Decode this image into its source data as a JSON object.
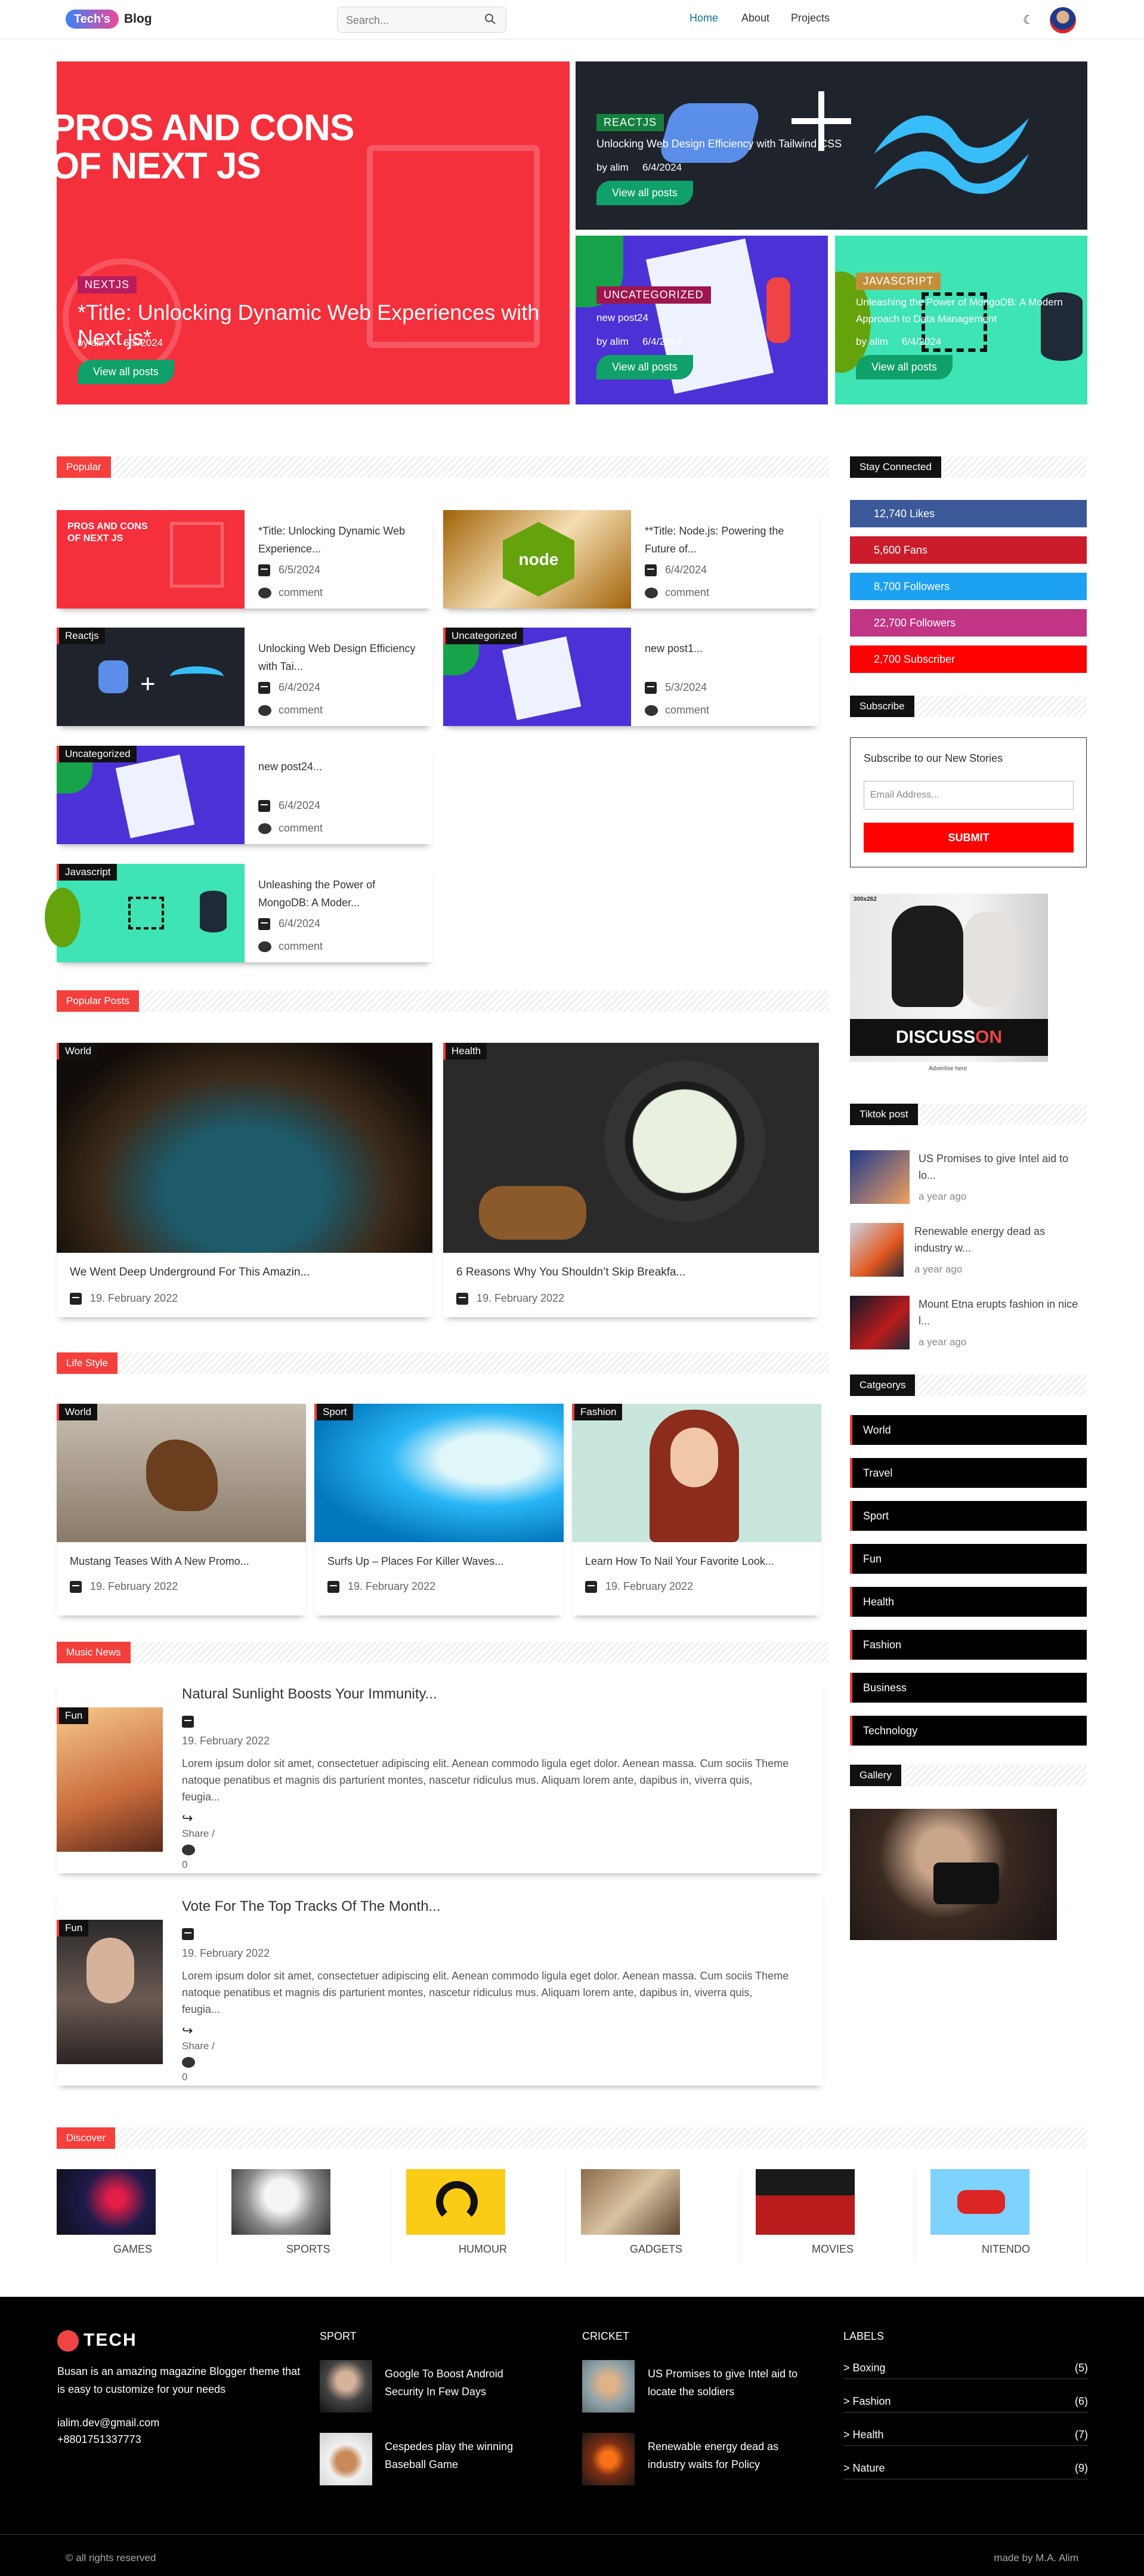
{
  "header": {
    "logo_badge": "Tech's",
    "logo_text": "Blog",
    "search_placeholder": "Search...",
    "nav": [
      "Home",
      "About",
      "Projects"
    ],
    "theme_icon": "moon-icon"
  },
  "hero": {
    "big": {
      "tag": "NEXTJS",
      "art_text_1": "PROS AND CONS",
      "art_text_2": "OF NEXT JS",
      "title": "*Title: Unlocking Dynamic Web Experiences with Next.js*",
      "author": "by alim",
      "date": "6/5/2024",
      "button": "View all posts"
    },
    "top_right": {
      "tag": "REACTJS",
      "title": "Unlocking Web Design Efficiency with Tailwind CSS",
      "author": "by alim",
      "date": "6/4/2024",
      "button": "View all posts"
    },
    "bottom_left": {
      "tag": "UNCATEGORIZED",
      "title": "new post24",
      "author": "by alim",
      "date": "6/4/2024",
      "button": "View all posts"
    },
    "bottom_right": {
      "tag": "JAVASCRIPT",
      "title": "Unleashing the Power of MongoDB: A Modern Approach to Data Management",
      "author": "by alim",
      "date": "6/4/2024",
      "button": "View all posts"
    }
  },
  "popular": {
    "heading": "Popular",
    "items": [
      {
        "tag": "",
        "art_text": "PROS AND CONS OF NEXT JS",
        "title": "*Title: Unlocking Dynamic Web Experience...",
        "date": "6/5/2024",
        "comment": "comment"
      },
      {
        "tag": "",
        "art_text": "node",
        "title": "**Title: Node.js: Powering the Future of...",
        "date": "6/4/2024",
        "comment": "comment"
      },
      {
        "tag": "Reactjs",
        "title": "Unlocking Web Design Efficiency with Tai...",
        "date": "6/4/2024",
        "comment": "comment"
      },
      {
        "tag": "Uncategorized",
        "title": "new post1...",
        "date": "5/3/2024",
        "comment": "comment"
      },
      {
        "tag": "Uncategorized",
        "title": "new post24...",
        "date": "6/4/2024",
        "comment": "comment"
      },
      {
        "tag": "Javascript",
        "title": "Unleashing the Power of MongoDB: A Moder...",
        "date": "6/4/2024",
        "comment": "comment"
      }
    ]
  },
  "popular_posts": {
    "heading": "Popular Posts",
    "items": [
      {
        "tag": "World",
        "title": "We Went Deep Underground For This Amazin...",
        "date": "19. February 2022"
      },
      {
        "tag": "Health",
        "title": "6 Reasons Why You Shouldn’t Skip Breakfa...",
        "date": "19. February 2022"
      }
    ]
  },
  "life_style": {
    "heading": "Life Style",
    "items": [
      {
        "tag": "World",
        "title": "Mustang Teases With A New Promo...",
        "date": "19. February 2022"
      },
      {
        "tag": "Sport",
        "title": "Surfs Up – Places For Killer Waves...",
        "date": "19. February 2022"
      },
      {
        "tag": "Fashion",
        "title": "Learn How To Nail Your Favorite Look...",
        "date": "19. February 2022"
      }
    ]
  },
  "music_news": {
    "heading": "Music News",
    "items": [
      {
        "tag": "Fun",
        "title": "Natural Sunlight Boosts Your Immunity...",
        "date": "19. February 2022",
        "body": "Lorem ipsum dolor sit amet, consectetuer adipiscing elit. Aenean commodo ligula eget dolor. Aenean massa. Cum sociis Theme natoque penatibus et magnis dis parturient montes, nascetur ridiculus mus. Aliquam lorem ante, dapibus in, viverra quis, feugia...",
        "share": "Share /",
        "comments": "0"
      },
      {
        "tag": "Fun",
        "title": "Vote For The Top Tracks Of The Month...",
        "date": "19. February 2022",
        "body": "Lorem ipsum dolor sit amet, consectetuer adipiscing elit. Aenean commodo ligula eget dolor. Aenean massa. Cum sociis Theme natoque penatibus et magnis dis parturient montes, nascetur ridiculus mus. Aliquam lorem ante, dapibus in, viverra quis, feugia...",
        "share": "Share /",
        "comments": "0"
      }
    ]
  },
  "discover": {
    "heading": "Discover",
    "items": [
      "GAMES",
      "SPORTS",
      "HUMOUR",
      "GADGETS",
      "MOVIES",
      "NITENDO"
    ]
  },
  "sidebar": {
    "stay_connected": "Stay Connected",
    "social": [
      {
        "label": "12,740 Likes",
        "color": "#3b5998"
      },
      {
        "label": "5,600 Fans",
        "color": "#cb1c2c"
      },
      {
        "label": "8,700 Followers",
        "color": "#1da1f2"
      },
      {
        "label": "22,700 Followers",
        "color": "#c13584"
      },
      {
        "label": "2,700 Subscriber",
        "color": "#ff0000"
      }
    ],
    "subscribe_heading": "Subscribe",
    "subscribe_title": "Subscribe to our New Stories",
    "email_placeholder": "Email Address...",
    "submit": "SUBMIT",
    "ad_size": "300x262",
    "ad_word_a": "DISCUSS",
    "ad_word_b": "ON",
    "ad_caption": "Advertise here",
    "tiktok_heading": "Tiktok post",
    "tiktok": [
      {
        "title": "US Promises to give Intel aid to lo...",
        "time": "a year ago"
      },
      {
        "title": "Renewable energy dead as industry w...",
        "time": "a year ago"
      },
      {
        "title": "Mount Etna erupts fashion in nice l...",
        "time": "a year ago"
      }
    ],
    "categories_heading": "Catgeorys",
    "categories": [
      "World",
      "Travel",
      "Sport",
      "Fun",
      "Health",
      "Fashion",
      "Business",
      "Technology"
    ],
    "gallery_heading": "Gallery"
  },
  "footer": {
    "brand": "TECH",
    "desc": "Busan is an amazing magazine Blogger theme that is easy to customize for your needs",
    "email": "ialim.dev@gmail.com",
    "phone": "+8801751337773",
    "sport_heading": "SPORT",
    "sport": [
      "Google To Boost Android Security In Few Days",
      "Cespedes play the winning Baseball Game"
    ],
    "cricket_heading": "CRICKET",
    "cricket": [
      "US Promises to give Intel aid to locate the soldiers",
      "Renewable energy dead as industry waits for Policy"
    ],
    "labels_heading": "LABELS",
    "labels": [
      {
        "name": "Boxing",
        "count": "(5)"
      },
      {
        "name": "Fashion",
        "count": "(6)"
      },
      {
        "name": "Health",
        "count": "(7)"
      },
      {
        "name": "Nature",
        "count": "(9)"
      }
    ],
    "copyright": "© all rights reserved",
    "made_by": "made by M.A. Alim"
  }
}
